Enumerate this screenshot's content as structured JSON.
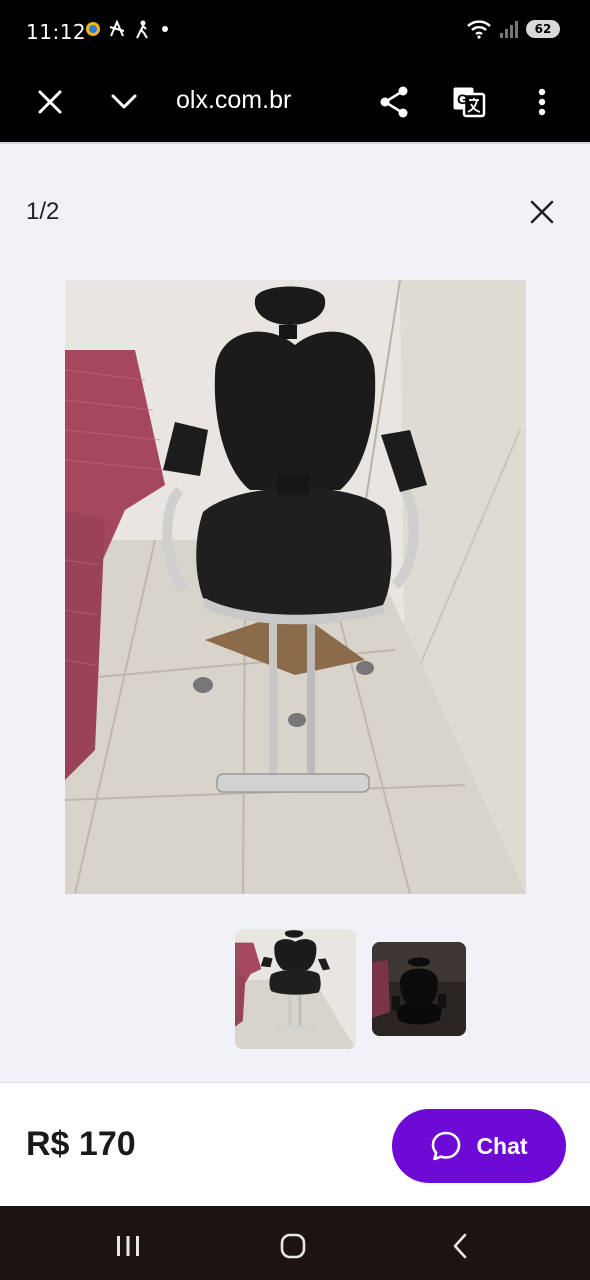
{
  "status_bar": {
    "time": "11:12",
    "battery": "62",
    "icons": [
      "notification-icon-1",
      "notification-icon-2",
      "notification-icon-3",
      "wifi-icon",
      "signal-icon"
    ]
  },
  "browser": {
    "url": "olx.com.br",
    "icons": [
      "close-icon",
      "chevron-down-icon",
      "share-icon",
      "translate-icon",
      "more-vert-icon"
    ]
  },
  "gallery": {
    "counter": "1/2",
    "photos": [
      "salon chair photo 1",
      "salon chair photo 2"
    ]
  },
  "listing": {
    "price": "R$ 170",
    "chat_label": "Chat",
    "accent_color": "#6e0ad6"
  },
  "nav": {
    "icons": [
      "recents-icon",
      "home-icon",
      "back-icon"
    ]
  }
}
